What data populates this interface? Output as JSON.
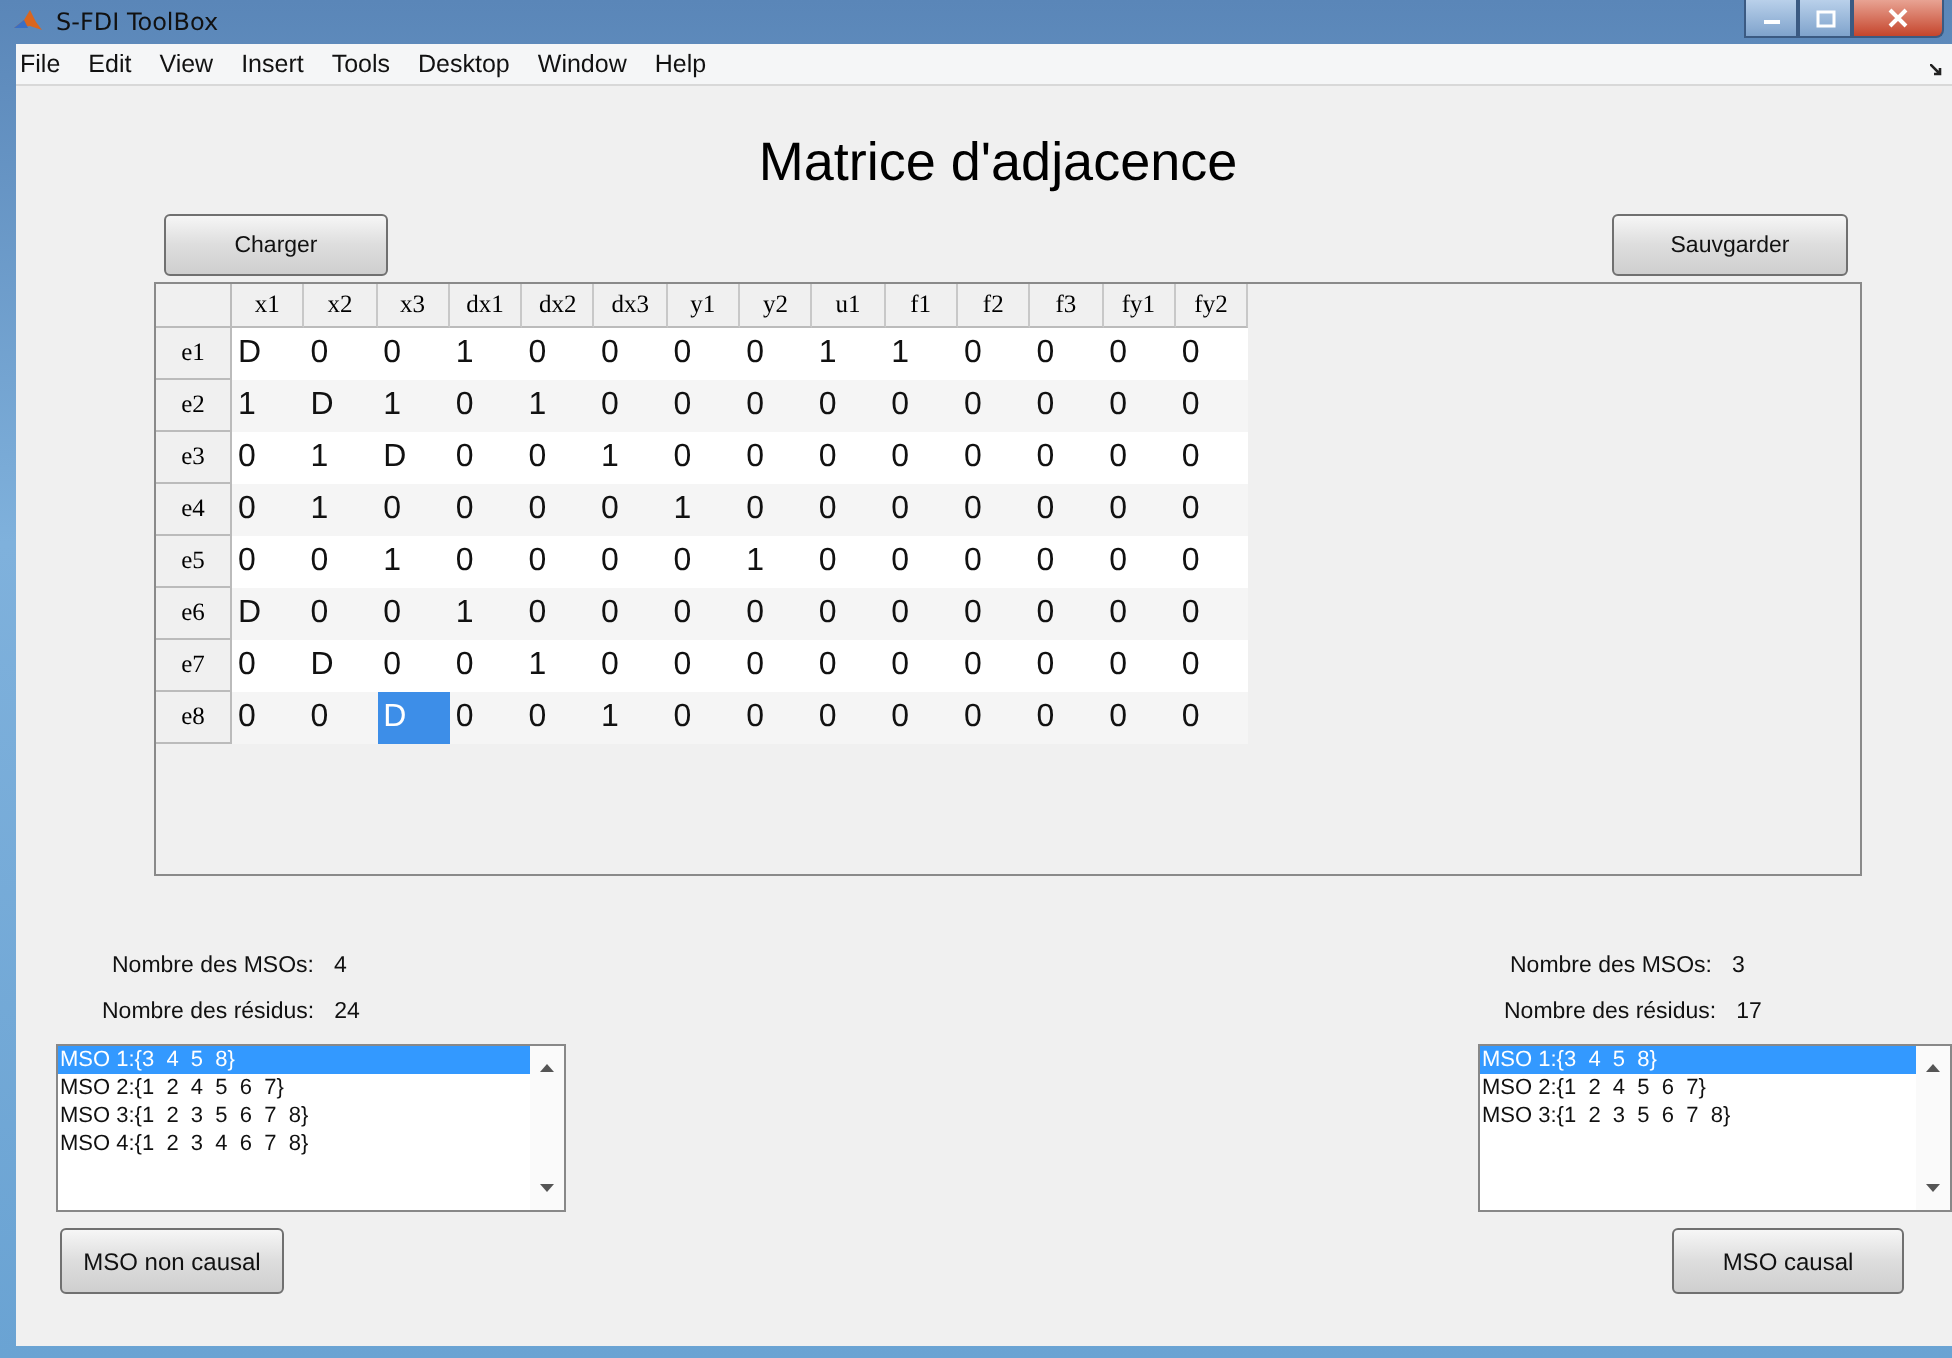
{
  "window": {
    "title": "S-FDI ToolBox"
  },
  "menu": [
    "File",
    "Edit",
    "View",
    "Insert",
    "Tools",
    "Desktop",
    "Window",
    "Help"
  ],
  "heading": "Matrice d'adjacence",
  "buttons_top": [
    "Charger",
    "Sauvgarder"
  ],
  "table": {
    "columns": [
      "x1",
      "x2",
      "x3",
      "dx1",
      "dx2",
      "dx3",
      "y1",
      "y2",
      "u1",
      "f1",
      "f2",
      "f3",
      "fy1",
      "fy2"
    ],
    "rows": [
      {
        "label": "e1",
        "cells": [
          {
            "v": "D",
            "selected": false
          },
          {
            "v": "0",
            "selected": false
          },
          {
            "v": "0",
            "selected": false
          },
          {
            "v": "1",
            "selected": false
          },
          {
            "v": "0",
            "selected": false
          },
          {
            "v": "0",
            "selected": false
          },
          {
            "v": "0",
            "selected": false
          },
          {
            "v": "0",
            "selected": false
          },
          {
            "v": "1",
            "selected": false
          },
          {
            "v": "1",
            "selected": false
          },
          {
            "v": "0",
            "selected": false
          },
          {
            "v": "0",
            "selected": false
          },
          {
            "v": "0",
            "selected": false
          },
          {
            "v": "0",
            "selected": false
          }
        ]
      },
      {
        "label": "e2",
        "cells": [
          {
            "v": "1",
            "selected": false
          },
          {
            "v": "D",
            "selected": false
          },
          {
            "v": "1",
            "selected": false
          },
          {
            "v": "0",
            "selected": false
          },
          {
            "v": "1",
            "selected": false
          },
          {
            "v": "0",
            "selected": false
          },
          {
            "v": "0",
            "selected": false
          },
          {
            "v": "0",
            "selected": false
          },
          {
            "v": "0",
            "selected": false
          },
          {
            "v": "0",
            "selected": false
          },
          {
            "v": "0",
            "selected": false
          },
          {
            "v": "0",
            "selected": false
          },
          {
            "v": "0",
            "selected": false
          },
          {
            "v": "0",
            "selected": false
          }
        ]
      },
      {
        "label": "e3",
        "cells": [
          {
            "v": "0",
            "selected": false
          },
          {
            "v": "1",
            "selected": false
          },
          {
            "v": "D",
            "selected": false
          },
          {
            "v": "0",
            "selected": false
          },
          {
            "v": "0",
            "selected": false
          },
          {
            "v": "1",
            "selected": false
          },
          {
            "v": "0",
            "selected": false
          },
          {
            "v": "0",
            "selected": false
          },
          {
            "v": "0",
            "selected": false
          },
          {
            "v": "0",
            "selected": false
          },
          {
            "v": "0",
            "selected": false
          },
          {
            "v": "0",
            "selected": false
          },
          {
            "v": "0",
            "selected": false
          },
          {
            "v": "0",
            "selected": false
          }
        ]
      },
      {
        "label": "e4",
        "cells": [
          {
            "v": "0",
            "selected": false
          },
          {
            "v": "1",
            "selected": false
          },
          {
            "v": "0",
            "selected": false
          },
          {
            "v": "0",
            "selected": false
          },
          {
            "v": "0",
            "selected": false
          },
          {
            "v": "0",
            "selected": false
          },
          {
            "v": "1",
            "selected": false
          },
          {
            "v": "0",
            "selected": false
          },
          {
            "v": "0",
            "selected": false
          },
          {
            "v": "0",
            "selected": false
          },
          {
            "v": "0",
            "selected": false
          },
          {
            "v": "0",
            "selected": false
          },
          {
            "v": "0",
            "selected": false
          },
          {
            "v": "0",
            "selected": false
          }
        ]
      },
      {
        "label": "e5",
        "cells": [
          {
            "v": "0",
            "selected": false
          },
          {
            "v": "0",
            "selected": false
          },
          {
            "v": "1",
            "selected": false
          },
          {
            "v": "0",
            "selected": false
          },
          {
            "v": "0",
            "selected": false
          },
          {
            "v": "0",
            "selected": false
          },
          {
            "v": "0",
            "selected": false
          },
          {
            "v": "1",
            "selected": false
          },
          {
            "v": "0",
            "selected": false
          },
          {
            "v": "0",
            "selected": false
          },
          {
            "v": "0",
            "selected": false
          },
          {
            "v": "0",
            "selected": false
          },
          {
            "v": "0",
            "selected": false
          },
          {
            "v": "0",
            "selected": false
          }
        ]
      },
      {
        "label": "e6",
        "cells": [
          {
            "v": "D",
            "selected": false
          },
          {
            "v": "0",
            "selected": false
          },
          {
            "v": "0",
            "selected": false
          },
          {
            "v": "1",
            "selected": false
          },
          {
            "v": "0",
            "selected": false
          },
          {
            "v": "0",
            "selected": false
          },
          {
            "v": "0",
            "selected": false
          },
          {
            "v": "0",
            "selected": false
          },
          {
            "v": "0",
            "selected": false
          },
          {
            "v": "0",
            "selected": false
          },
          {
            "v": "0",
            "selected": false
          },
          {
            "v": "0",
            "selected": false
          },
          {
            "v": "0",
            "selected": false
          },
          {
            "v": "0",
            "selected": false
          }
        ]
      },
      {
        "label": "e7",
        "cells": [
          {
            "v": "0",
            "selected": false
          },
          {
            "v": "D",
            "selected": false
          },
          {
            "v": "0",
            "selected": false
          },
          {
            "v": "0",
            "selected": false
          },
          {
            "v": "1",
            "selected": false
          },
          {
            "v": "0",
            "selected": false
          },
          {
            "v": "0",
            "selected": false
          },
          {
            "v": "0",
            "selected": false
          },
          {
            "v": "0",
            "selected": false
          },
          {
            "v": "0",
            "selected": false
          },
          {
            "v": "0",
            "selected": false
          },
          {
            "v": "0",
            "selected": false
          },
          {
            "v": "0",
            "selected": false
          },
          {
            "v": "0",
            "selected": false
          }
        ]
      },
      {
        "label": "e8",
        "cells": [
          {
            "v": "0",
            "selected": false
          },
          {
            "v": "0",
            "selected": false
          },
          {
            "v": "D",
            "selected": true
          },
          {
            "v": "0",
            "selected": false
          },
          {
            "v": "0",
            "selected": false
          },
          {
            "v": "1",
            "selected": false
          },
          {
            "v": "0",
            "selected": false
          },
          {
            "v": "0",
            "selected": false
          },
          {
            "v": "0",
            "selected": false
          },
          {
            "v": "0",
            "selected": false
          },
          {
            "v": "0",
            "selected": false
          },
          {
            "v": "0",
            "selected": false
          },
          {
            "v": "0",
            "selected": false
          },
          {
            "v": "0",
            "selected": false
          }
        ]
      }
    ]
  },
  "panels": [
    {
      "mso_label": "Nombre des MSOs:",
      "mso_count": "4",
      "res_label": "Nombre des résidus:",
      "res_count": "24",
      "items": [
        {
          "text": "MSO 1:{3  4  5  8}",
          "selected": true
        },
        {
          "text": "MSO 2:{1  2  4  5  6  7}",
          "selected": false
        },
        {
          "text": "MSO 3:{1  2  3  5  6  7  8}",
          "selected": false
        },
        {
          "text": "MSO 4:{1  2  3  4  6  7  8}",
          "selected": false
        }
      ],
      "button": "MSO non causal"
    },
    {
      "mso_label": "Nombre des MSOs:",
      "mso_count": "3",
      "res_label": "Nombre des résidus:",
      "res_count": "17",
      "items": [
        {
          "text": "MSO 1:{3  4  5  8}",
          "selected": true
        },
        {
          "text": "MSO 2:{1  2  4  5  6  7}",
          "selected": false
        },
        {
          "text": "MSO 3:{1  2  3  5  6  7  8}",
          "selected": false
        }
      ],
      "button": "MSO causal"
    }
  ]
}
